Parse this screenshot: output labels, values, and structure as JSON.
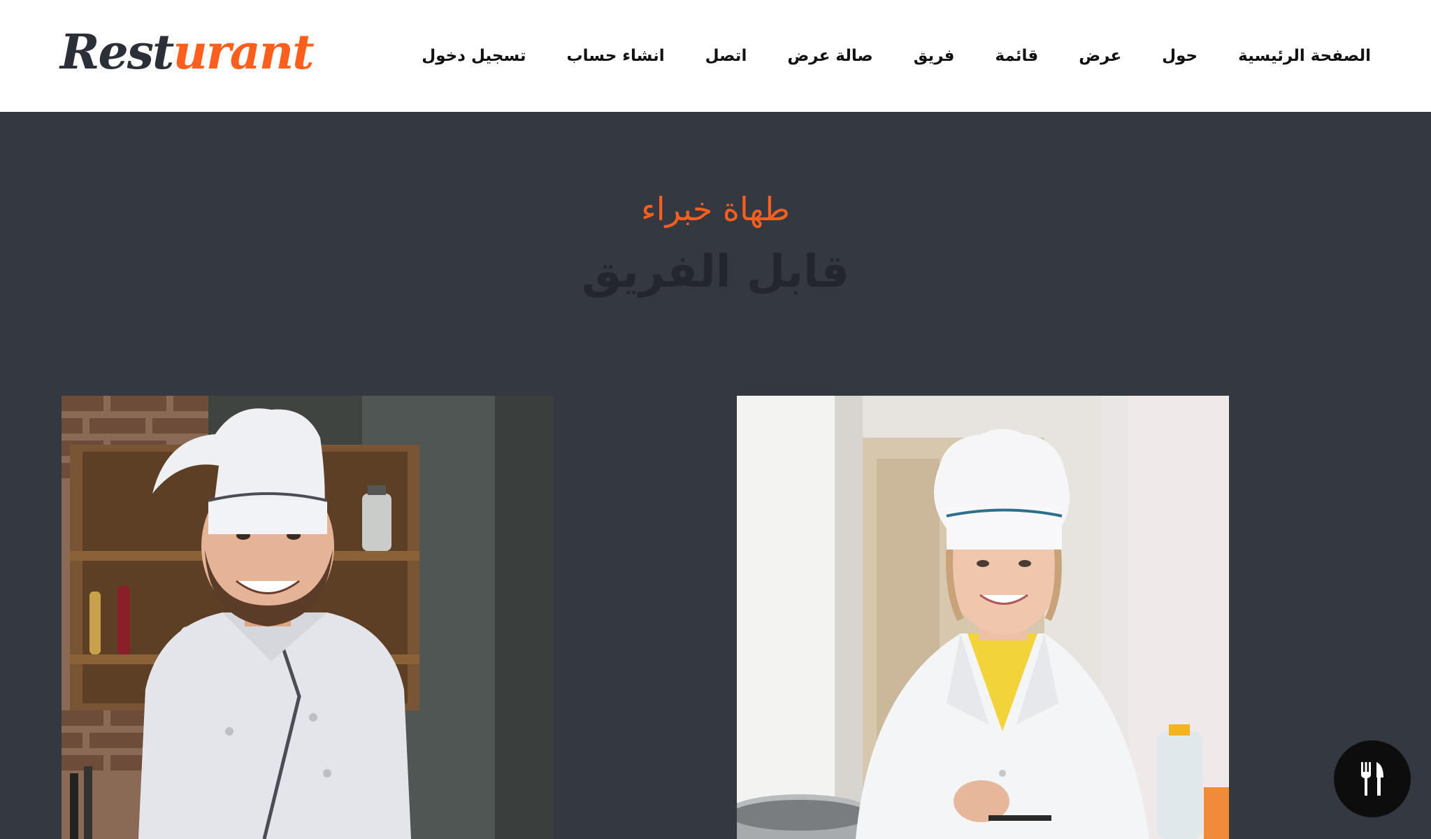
{
  "header": {
    "logo": {
      "part_a": "Rest",
      "part_b": "urant"
    },
    "nav": [
      "تسجيل دخول",
      "انشاء حساب",
      "اتصل",
      "صالة عرض",
      "فريق",
      "قائمة",
      "عرض",
      "حول",
      "الصفحة الرئيسية"
    ]
  },
  "section": {
    "kicker": "طهاة خبراء",
    "title": "قابل الفريق"
  },
  "team": [
    {
      "photo": "male-chef-photo"
    },
    {
      "photo": "female-chef-photo"
    }
  ],
  "fab": {
    "icon": "fork-knife-icon"
  },
  "colors": {
    "accent": "#fe5f1c",
    "header_bg": "#ffffff",
    "section_bg": "#343841",
    "title_text": "#23262d",
    "fab_bg": "#0d0d0d"
  }
}
